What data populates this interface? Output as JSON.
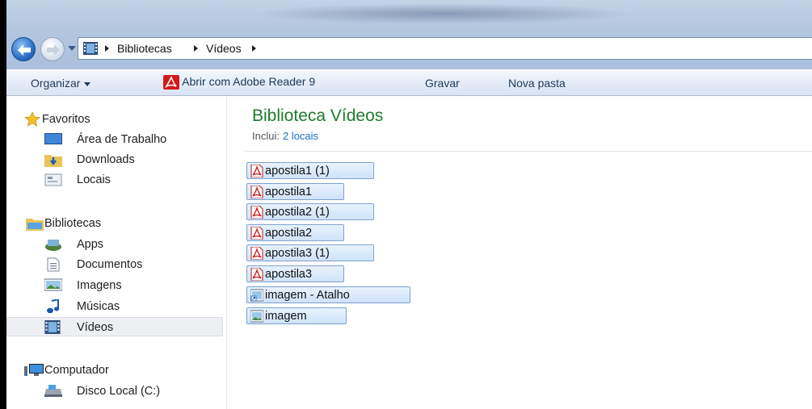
{
  "address": {
    "crumbs": [
      "Bibliotecas",
      "Vídeos"
    ]
  },
  "toolbar": {
    "organize": "Organizar",
    "open_with": "Abrir com Adobe Reader 9",
    "burn": "Gravar",
    "new_folder": "Nova pasta"
  },
  "nav": {
    "favorites": {
      "label": "Favoritos",
      "items": [
        "Área de Trabalho",
        "Downloads",
        "Locais"
      ]
    },
    "libraries": {
      "label": "Bibliotecas",
      "items": [
        "Apps",
        "Documentos",
        "Imagens",
        "Músicas",
        "Vídeos"
      ],
      "selected": "Vídeos"
    },
    "computer": {
      "label": "Computador",
      "items": [
        "Disco Local (C:)"
      ]
    }
  },
  "content": {
    "title": "Biblioteca Vídeos",
    "includes_label": "Inclui:",
    "includes_link": "2 locais",
    "files": [
      {
        "name": "apostila1 (1)",
        "icon": "pdf-icon"
      },
      {
        "name": "apostila1",
        "icon": "pdf-icon"
      },
      {
        "name": "apostila2 (1)",
        "icon": "pdf-icon"
      },
      {
        "name": "apostila2",
        "icon": "pdf-icon"
      },
      {
        "name": "apostila3 (1)",
        "icon": "pdf-icon"
      },
      {
        "name": "apostila3",
        "icon": "pdf-icon"
      },
      {
        "name": "imagem - Atalho",
        "icon": "image-shortcut-icon"
      },
      {
        "name": "imagem",
        "icon": "image-icon"
      }
    ]
  },
  "colors": {
    "title_green": "#1e7b2a",
    "link_blue": "#1f6bc4",
    "selection_blue": "#cfe3fb"
  }
}
